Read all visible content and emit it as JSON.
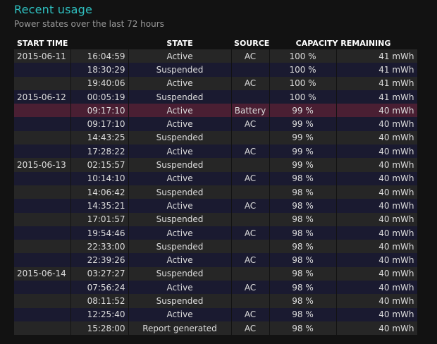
{
  "title": "Recent usage",
  "subtitle": "Power states over the last 72 hours",
  "columns": {
    "start_time": "START TIME",
    "state": "STATE",
    "source": "SOURCE",
    "capacity": "CAPACITY REMAINING"
  },
  "rows": [
    {
      "date": "2015-06-11",
      "time": "16:04:59",
      "state": "Active",
      "source": "AC",
      "percent": "100 %",
      "mwh": "41 mWh",
      "highlight": false
    },
    {
      "date": "",
      "time": "18:30:29",
      "state": "Suspended",
      "source": "",
      "percent": "100 %",
      "mwh": "41 mWh",
      "highlight": false
    },
    {
      "date": "",
      "time": "19:40:06",
      "state": "Active",
      "source": "AC",
      "percent": "100 %",
      "mwh": "41 mWh",
      "highlight": false
    },
    {
      "date": "2015-06-12",
      "time": "00:05:19",
      "state": "Suspended",
      "source": "",
      "percent": "100 %",
      "mwh": "41 mWh",
      "highlight": false
    },
    {
      "date": "",
      "time": "09:17:10",
      "state": "Active",
      "source": "Battery",
      "percent": "99 %",
      "mwh": "40 mWh",
      "highlight": true
    },
    {
      "date": "",
      "time": "09:17:10",
      "state": "Active",
      "source": "AC",
      "percent": "99 %",
      "mwh": "40 mWh",
      "highlight": false
    },
    {
      "date": "",
      "time": "14:43:25",
      "state": "Suspended",
      "source": "",
      "percent": "99 %",
      "mwh": "40 mWh",
      "highlight": false
    },
    {
      "date": "",
      "time": "17:28:22",
      "state": "Active",
      "source": "AC",
      "percent": "99 %",
      "mwh": "40 mWh",
      "highlight": false
    },
    {
      "date": "2015-06-13",
      "time": "02:15:57",
      "state": "Suspended",
      "source": "",
      "percent": "99 %",
      "mwh": "40 mWh",
      "highlight": false
    },
    {
      "date": "",
      "time": "10:14:10",
      "state": "Active",
      "source": "AC",
      "percent": "98 %",
      "mwh": "40 mWh",
      "highlight": false
    },
    {
      "date": "",
      "time": "14:06:42",
      "state": "Suspended",
      "source": "",
      "percent": "98 %",
      "mwh": "40 mWh",
      "highlight": false
    },
    {
      "date": "",
      "time": "14:35:21",
      "state": "Active",
      "source": "AC",
      "percent": "98 %",
      "mwh": "40 mWh",
      "highlight": false
    },
    {
      "date": "",
      "time": "17:01:57",
      "state": "Suspended",
      "source": "",
      "percent": "98 %",
      "mwh": "40 mWh",
      "highlight": false
    },
    {
      "date": "",
      "time": "19:54:46",
      "state": "Active",
      "source": "AC",
      "percent": "98 %",
      "mwh": "40 mWh",
      "highlight": false
    },
    {
      "date": "",
      "time": "22:33:00",
      "state": "Suspended",
      "source": "",
      "percent": "98 %",
      "mwh": "40 mWh",
      "highlight": false
    },
    {
      "date": "",
      "time": "22:39:26",
      "state": "Active",
      "source": "AC",
      "percent": "98 %",
      "mwh": "40 mWh",
      "highlight": false
    },
    {
      "date": "2015-06-14",
      "time": "03:27:27",
      "state": "Suspended",
      "source": "",
      "percent": "98 %",
      "mwh": "40 mWh",
      "highlight": false
    },
    {
      "date": "",
      "time": "07:56:24",
      "state": "Active",
      "source": "AC",
      "percent": "98 %",
      "mwh": "40 mWh",
      "highlight": false
    },
    {
      "date": "",
      "time": "08:11:52",
      "state": "Suspended",
      "source": "",
      "percent": "98 %",
      "mwh": "40 mWh",
      "highlight": false
    },
    {
      "date": "",
      "time": "12:25:40",
      "state": "Active",
      "source": "AC",
      "percent": "98 %",
      "mwh": "40 mWh",
      "highlight": false
    },
    {
      "date": "",
      "time": "15:28:00",
      "state": "Report generated",
      "source": "AC",
      "percent": "98 %",
      "mwh": "40 mWh",
      "highlight": false
    }
  ]
}
